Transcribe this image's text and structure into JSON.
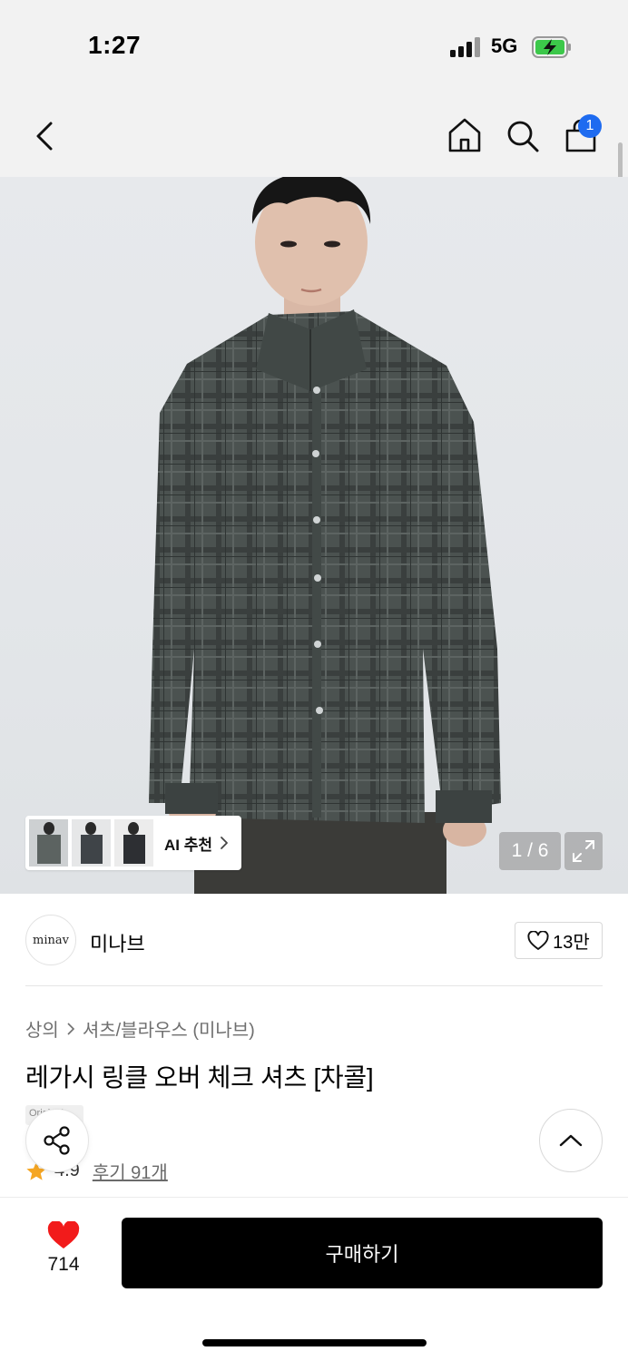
{
  "status_bar": {
    "time": "1:27",
    "network": "5G"
  },
  "nav": {
    "cart_badge": "1"
  },
  "gallery": {
    "ai_label": "AI 추천",
    "counter": "1 / 6"
  },
  "brand": {
    "logo_text": "minav",
    "name": "미나브",
    "likes": "13만"
  },
  "breadcrumb": {
    "category": "상의",
    "subcategory": "셔츠/블라우스 (미나브)"
  },
  "product": {
    "title": "레가시 링클 오버 체크 셔츠 [차콜]",
    "tag": "Original",
    "rating": "4.9",
    "reviews": "후기 91개"
  },
  "bottom_bar": {
    "like_count": "714",
    "buy_label": "구매하기"
  },
  "colors": {
    "badge": "#1e6bf0",
    "star": "#f5a623",
    "heart": "#f21b1b",
    "buy_button": "#000000"
  }
}
